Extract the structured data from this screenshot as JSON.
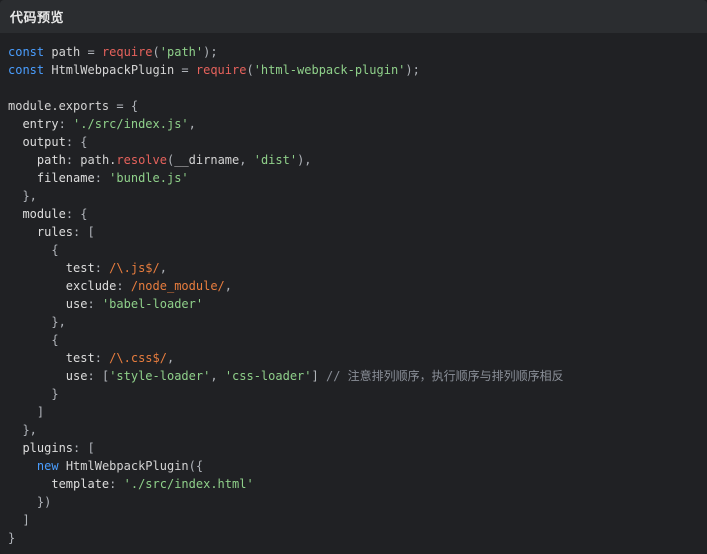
{
  "header": {
    "title": "代码预览"
  },
  "code": {
    "lines": [
      [
        [
          "kw",
          "const"
        ],
        [
          "t",
          " path "
        ],
        [
          "pun",
          "="
        ],
        [
          "t",
          " "
        ],
        [
          "fn",
          "require"
        ],
        [
          "pun",
          "("
        ],
        [
          "str",
          "'path'"
        ],
        [
          "pun",
          ");"
        ]
      ],
      [
        [
          "kw",
          "const"
        ],
        [
          "t",
          " HtmlWebpackPlugin "
        ],
        [
          "pun",
          "="
        ],
        [
          "t",
          " "
        ],
        [
          "fn",
          "require"
        ],
        [
          "pun",
          "("
        ],
        [
          "str",
          "'html-webpack-plugin'"
        ],
        [
          "pun",
          ");"
        ]
      ],
      [],
      [
        [
          "t",
          "module.exports "
        ],
        [
          "pun",
          "="
        ],
        [
          "t",
          " "
        ],
        [
          "pun",
          "{"
        ]
      ],
      [
        [
          "t",
          "  "
        ],
        [
          "prop",
          "entry"
        ],
        [
          "pun",
          ":"
        ],
        [
          "t",
          " "
        ],
        [
          "str",
          "'./src/index.js'"
        ],
        [
          "pun",
          ","
        ]
      ],
      [
        [
          "t",
          "  "
        ],
        [
          "prop",
          "output"
        ],
        [
          "pun",
          ":"
        ],
        [
          "t",
          " "
        ],
        [
          "pun",
          "{"
        ]
      ],
      [
        [
          "t",
          "    "
        ],
        [
          "prop",
          "path"
        ],
        [
          "pun",
          ":"
        ],
        [
          "t",
          " path."
        ],
        [
          "fn",
          "resolve"
        ],
        [
          "pun",
          "("
        ],
        [
          "t",
          "__dirname"
        ],
        [
          "pun",
          ","
        ],
        [
          "t",
          " "
        ],
        [
          "str",
          "'dist'"
        ],
        [
          "pun",
          "),"
        ]
      ],
      [
        [
          "t",
          "    "
        ],
        [
          "prop",
          "filename"
        ],
        [
          "pun",
          ":"
        ],
        [
          "t",
          " "
        ],
        [
          "str",
          "'bundle.js'"
        ]
      ],
      [
        [
          "t",
          "  "
        ],
        [
          "pun",
          "},"
        ]
      ],
      [
        [
          "t",
          "  "
        ],
        [
          "prop",
          "module"
        ],
        [
          "pun",
          ":"
        ],
        [
          "t",
          " "
        ],
        [
          "pun",
          "{"
        ]
      ],
      [
        [
          "t",
          "    "
        ],
        [
          "prop",
          "rules"
        ],
        [
          "pun",
          ":"
        ],
        [
          "t",
          " "
        ],
        [
          "pun",
          "["
        ]
      ],
      [
        [
          "t",
          "      "
        ],
        [
          "pun",
          "{"
        ]
      ],
      [
        [
          "t",
          "        "
        ],
        [
          "prop",
          "test"
        ],
        [
          "pun",
          ":"
        ],
        [
          "t",
          " "
        ],
        [
          "re",
          "/\\.js$/"
        ],
        [
          "pun",
          ","
        ]
      ],
      [
        [
          "t",
          "        "
        ],
        [
          "prop",
          "exclude"
        ],
        [
          "pun",
          ":"
        ],
        [
          "t",
          " "
        ],
        [
          "re",
          "/node_module/"
        ],
        [
          "pun",
          ","
        ]
      ],
      [
        [
          "t",
          "        "
        ],
        [
          "prop",
          "use"
        ],
        [
          "pun",
          ":"
        ],
        [
          "t",
          " "
        ],
        [
          "str",
          "'babel-loader'"
        ]
      ],
      [
        [
          "t",
          "      "
        ],
        [
          "pun",
          "},"
        ]
      ],
      [
        [
          "t",
          "      "
        ],
        [
          "pun",
          "{"
        ]
      ],
      [
        [
          "t",
          "        "
        ],
        [
          "prop",
          "test"
        ],
        [
          "pun",
          ":"
        ],
        [
          "t",
          " "
        ],
        [
          "re",
          "/\\.css$/"
        ],
        [
          "pun",
          ","
        ]
      ],
      [
        [
          "t",
          "        "
        ],
        [
          "prop",
          "use"
        ],
        [
          "pun",
          ":"
        ],
        [
          "t",
          " "
        ],
        [
          "pun",
          "["
        ],
        [
          "str",
          "'style-loader'"
        ],
        [
          "pun",
          ","
        ],
        [
          "t",
          " "
        ],
        [
          "str",
          "'css-loader'"
        ],
        [
          "pun",
          "]"
        ],
        [
          "t",
          " "
        ],
        [
          "com",
          "// 注意排列顺序，执行顺序与排列顺序相反"
        ]
      ],
      [
        [
          "t",
          "      "
        ],
        [
          "pun",
          "}"
        ]
      ],
      [
        [
          "t",
          "    "
        ],
        [
          "pun",
          "]"
        ]
      ],
      [
        [
          "t",
          "  "
        ],
        [
          "pun",
          "},"
        ]
      ],
      [
        [
          "t",
          "  "
        ],
        [
          "prop",
          "plugins"
        ],
        [
          "pun",
          ":"
        ],
        [
          "t",
          " "
        ],
        [
          "pun",
          "["
        ]
      ],
      [
        [
          "t",
          "    "
        ],
        [
          "kw",
          "new"
        ],
        [
          "t",
          " HtmlWebpackPlugin"
        ],
        [
          "pun",
          "({"
        ]
      ],
      [
        [
          "t",
          "      "
        ],
        [
          "prop",
          "template"
        ],
        [
          "pun",
          ":"
        ],
        [
          "t",
          " "
        ],
        [
          "str",
          "'./src/index.html'"
        ]
      ],
      [
        [
          "t",
          "    "
        ],
        [
          "pun",
          "})"
        ]
      ],
      [
        [
          "t",
          "  "
        ],
        [
          "pun",
          "]"
        ]
      ],
      [
        [
          "pun",
          "}"
        ]
      ]
    ]
  }
}
